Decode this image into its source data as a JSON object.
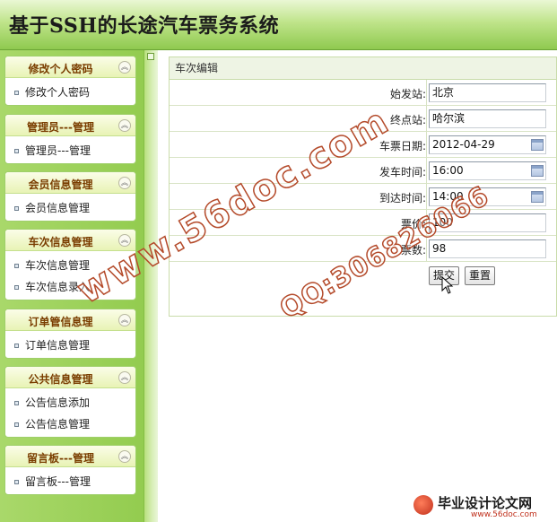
{
  "app_title": "基于SSH的长途汽车票务系统",
  "sidebar": {
    "panels": [
      {
        "title": "修改个人密码",
        "items": [
          "修改个人密码"
        ]
      },
      {
        "title": "管理员---管理",
        "items": [
          "管理员---管理"
        ]
      },
      {
        "title": "会员信息管理",
        "items": [
          "会员信息管理"
        ]
      },
      {
        "title": "车次信息管理",
        "items": [
          "车次信息管理",
          "车次信息录入"
        ]
      },
      {
        "title": "订单管信息理",
        "items": [
          "订单信息管理"
        ]
      },
      {
        "title": "公共信息管理",
        "items": [
          "公告信息添加",
          "公告信息管理"
        ]
      },
      {
        "title": "留言板---管理",
        "items": [
          "留言板---管理"
        ]
      }
    ],
    "collapse_glyph": "︽"
  },
  "form": {
    "caption": "车次编辑",
    "fields": [
      {
        "label": "始发站:",
        "value": "北京",
        "calendar": false
      },
      {
        "label": "终点站:",
        "value": "哈尔滨",
        "calendar": false
      },
      {
        "label": "车票日期:",
        "value": "2012-04-29",
        "calendar": true
      },
      {
        "label": "发车时间:",
        "value": "16:00",
        "calendar": true
      },
      {
        "label": "到达时间:",
        "value": "14:00",
        "calendar": true
      },
      {
        "label": "票价:",
        "value": "100",
        "calendar": false
      },
      {
        "label": "票数:",
        "value": "98",
        "calendar": false
      }
    ],
    "submit_label": "提交",
    "reset_label": "重置"
  },
  "watermarks": {
    "site": "www.56doc.com",
    "qq": "QQ:306826066"
  },
  "footer_logo": {
    "text": "毕业设计论文网",
    "url": "www.56doc.com"
  }
}
